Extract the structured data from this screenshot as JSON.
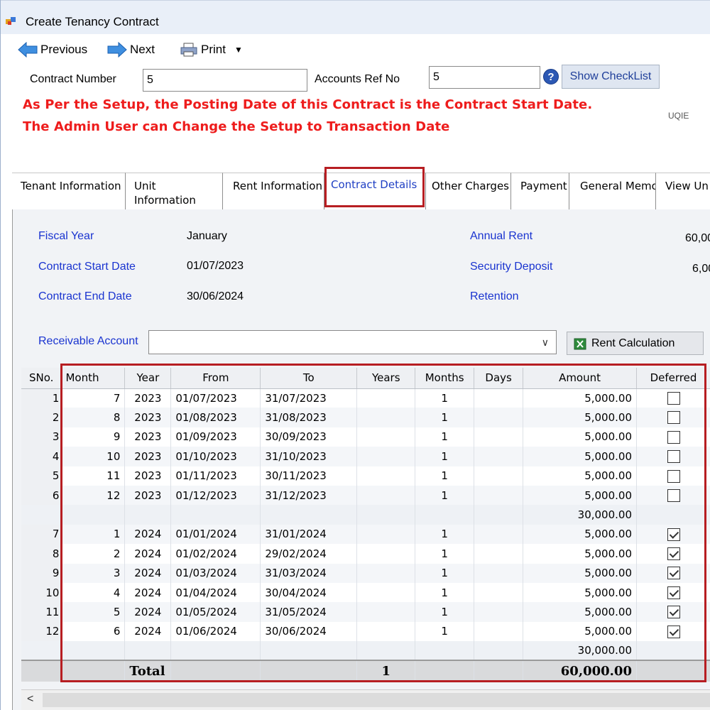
{
  "window": {
    "title": "Create Tenancy Contract"
  },
  "toolbar": {
    "previous": "Previous",
    "next": "Next",
    "print": "Print"
  },
  "form": {
    "contract_number_label": "Contract Number",
    "contract_number_value": "5",
    "accounts_ref_label": "Accounts Ref No",
    "accounts_ref_value": "5",
    "show_checklist": "Show CheckList",
    "help": "?",
    "cut_text": "UQIE"
  },
  "warnings": [
    "As Per the Setup, the Posting Date of this Contract is the Contract Start Date.",
    "The Admin User can Change the Setup to Transaction Date"
  ],
  "tabs": [
    {
      "label": "Tenant Information"
    },
    {
      "label": "Unit\nInformation"
    },
    {
      "label": "Rent Information"
    },
    {
      "label": "Contract Details"
    },
    {
      "label": "Other Charges"
    },
    {
      "label": "Payment"
    },
    {
      "label": "General Memo"
    },
    {
      "label": "View Un"
    }
  ],
  "details": {
    "fiscal_year_label": "Fiscal Year",
    "fiscal_year_value": "January",
    "start_label": "Contract Start Date",
    "start_value": "01/07/2023",
    "end_label": "Contract End Date",
    "end_value": "30/06/2024",
    "annual_rent_label": "Annual Rent",
    "annual_rent_value": "60,00",
    "security_label": "Security Deposit",
    "security_value": "6,00",
    "retention_label": "Retention",
    "receivable_label": "Receivable Account",
    "receivable_value": "",
    "rent_calc": "Rent Calculation"
  },
  "grid": {
    "headers": [
      "SNo.",
      "Month",
      "Year",
      "From",
      "To",
      "Years",
      "Months",
      "Days",
      "Amount",
      "Deferred"
    ],
    "rows": [
      {
        "type": "row",
        "sno": "1",
        "month": "7",
        "year": "2023",
        "from": "01/07/2023",
        "to": "31/07/2023",
        "years": "",
        "months": "1",
        "days": "",
        "amount": "5,000.00",
        "deferred": false
      },
      {
        "type": "row",
        "sno": "2",
        "month": "8",
        "year": "2023",
        "from": "01/08/2023",
        "to": "31/08/2023",
        "years": "",
        "months": "1",
        "days": "",
        "amount": "5,000.00",
        "deferred": false
      },
      {
        "type": "row",
        "sno": "3",
        "month": "9",
        "year": "2023",
        "from": "01/09/2023",
        "to": "30/09/2023",
        "years": "",
        "months": "1",
        "days": "",
        "amount": "5,000.00",
        "deferred": false
      },
      {
        "type": "row",
        "sno": "4",
        "month": "10",
        "year": "2023",
        "from": "01/10/2023",
        "to": "31/10/2023",
        "years": "",
        "months": "1",
        "days": "",
        "amount": "5,000.00",
        "deferred": false
      },
      {
        "type": "row",
        "sno": "5",
        "month": "11",
        "year": "2023",
        "from": "01/11/2023",
        "to": "30/11/2023",
        "years": "",
        "months": "1",
        "days": "",
        "amount": "5,000.00",
        "deferred": false
      },
      {
        "type": "row",
        "sno": "6",
        "month": "12",
        "year": "2023",
        "from": "01/12/2023",
        "to": "31/12/2023",
        "years": "",
        "months": "1",
        "days": "",
        "amount": "5,000.00",
        "deferred": false
      },
      {
        "type": "subtotal",
        "amount": "30,000.00"
      },
      {
        "type": "row",
        "sno": "7",
        "month": "1",
        "year": "2024",
        "from": "01/01/2024",
        "to": "31/01/2024",
        "years": "",
        "months": "1",
        "days": "",
        "amount": "5,000.00",
        "deferred": true
      },
      {
        "type": "row",
        "sno": "8",
        "month": "2",
        "year": "2024",
        "from": "01/02/2024",
        "to": "29/02/2024",
        "years": "",
        "months": "1",
        "days": "",
        "amount": "5,000.00",
        "deferred": true
      },
      {
        "type": "row",
        "sno": "9",
        "month": "3",
        "year": "2024",
        "from": "01/03/2024",
        "to": "31/03/2024",
        "years": "",
        "months": "1",
        "days": "",
        "amount": "5,000.00",
        "deferred": true
      },
      {
        "type": "row",
        "sno": "10",
        "month": "4",
        "year": "2024",
        "from": "01/04/2024",
        "to": "30/04/2024",
        "years": "",
        "months": "1",
        "days": "",
        "amount": "5,000.00",
        "deferred": true
      },
      {
        "type": "row",
        "sno": "11",
        "month": "5",
        "year": "2024",
        "from": "01/05/2024",
        "to": "31/05/2024",
        "years": "",
        "months": "1",
        "days": "",
        "amount": "5,000.00",
        "deferred": true
      },
      {
        "type": "row",
        "sno": "12",
        "month": "6",
        "year": "2024",
        "from": "01/06/2024",
        "to": "30/06/2024",
        "years": "",
        "months": "1",
        "days": "",
        "amount": "5,000.00",
        "deferred": true
      },
      {
        "type": "subtotal",
        "amount": "30,000.00"
      }
    ],
    "total": {
      "label": "Total",
      "years": "1",
      "amount": "60,000.00"
    }
  },
  "scroll": {
    "left_arrow": "<"
  },
  "colors": {
    "accent_red": "#b71e22",
    "label_blue": "#1a34d0",
    "warning_red": "#ee1c1c"
  },
  "icons": [
    "app-icon",
    "previous-arrow-icon",
    "next-arrow-icon",
    "printer-icon",
    "dropdown-caret-icon",
    "help-icon",
    "excel-icon",
    "combo-arrow-icon",
    "checkbox-icon"
  ]
}
